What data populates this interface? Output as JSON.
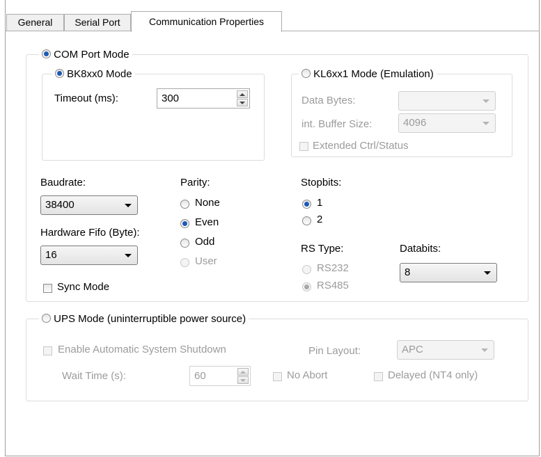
{
  "tabs": [
    "General",
    "Serial Port",
    "Communication Properties"
  ],
  "com_port_mode": {
    "label": "COM Port Mode",
    "bk_mode": {
      "label": "BK8xx0 Mode",
      "timeout_label": "Timeout (ms):",
      "timeout_value": "300"
    },
    "kl_mode": {
      "label": "KL6xx1 Mode (Emulation)",
      "data_bytes_label": "Data Bytes:",
      "data_bytes_value": "",
      "buffer_label": "int. Buffer Size:",
      "buffer_value": "4096",
      "extended_label": "Extended Ctrl/Status"
    },
    "baudrate_label": "Baudrate:",
    "baudrate_value": "38400",
    "fifo_label": "Hardware Fifo (Byte):",
    "fifo_value": "16",
    "sync_label": "Sync Mode",
    "parity_label": "Parity:",
    "parity_options": [
      "None",
      "Even",
      "Odd",
      "User"
    ],
    "stopbits_label": "Stopbits:",
    "stopbits_options": [
      "1",
      "2"
    ],
    "rs_type_label": "RS Type:",
    "rs_type_options": [
      "RS232",
      "RS485"
    ],
    "databits_label": "Databits:",
    "databits_value": "8"
  },
  "ups_mode": {
    "label": "UPS Mode (uninterruptible power source)",
    "shutdown_label": "Enable Automatic System Shutdown",
    "pin_layout_label": "Pin Layout:",
    "pin_layout_value": "APC",
    "wait_time_label": "Wait Time (s):",
    "wait_time_value": "60",
    "no_abort_label": "No Abort",
    "delayed_label": "Delayed (NT4 only)"
  }
}
